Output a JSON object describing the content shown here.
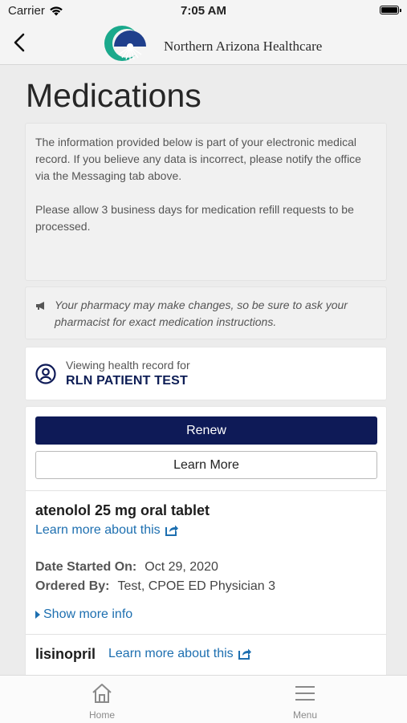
{
  "status_bar": {
    "carrier": "Carrier",
    "time": "7:05 AM"
  },
  "nav": {
    "back_icon": "chevron-left-icon",
    "logo_text": "Northern Arizona Healthcare"
  },
  "page": {
    "title": "Medications"
  },
  "info": {
    "paragraph1": "The information provided below is part of your electronic medical record. If you believe any data is incorrect, please notify the office via the Messaging tab above.",
    "paragraph2": "Please allow 3 business days for medication refill requests to be processed."
  },
  "notice": {
    "icon": "megaphone-icon",
    "text": "Your pharmacy may make changes, so be sure to ask your pharmacist for exact medication instructions."
  },
  "patient": {
    "label": "Viewing health record for",
    "name": "RLN PATIENT TEST"
  },
  "actions": {
    "renew_label": "Renew",
    "learn_more_label": "Learn More"
  },
  "medications": [
    {
      "name": "atenolol 25 mg oral tablet",
      "learn_link": "Learn more about this",
      "date_started_label": "Date Started On:",
      "date_started": "Oct 29, 2020",
      "ordered_by_label": "Ordered By:",
      "ordered_by": "Test, CPOE ED Physician 3",
      "show_more": "Show more info"
    },
    {
      "name": "lisinopril",
      "learn_link": "Learn more about this"
    }
  ],
  "tabbar": {
    "home_label": "Home",
    "menu_label": "Menu"
  },
  "colors": {
    "primary": "#0e1a57",
    "link": "#1d6fb0",
    "background": "#ececec"
  }
}
